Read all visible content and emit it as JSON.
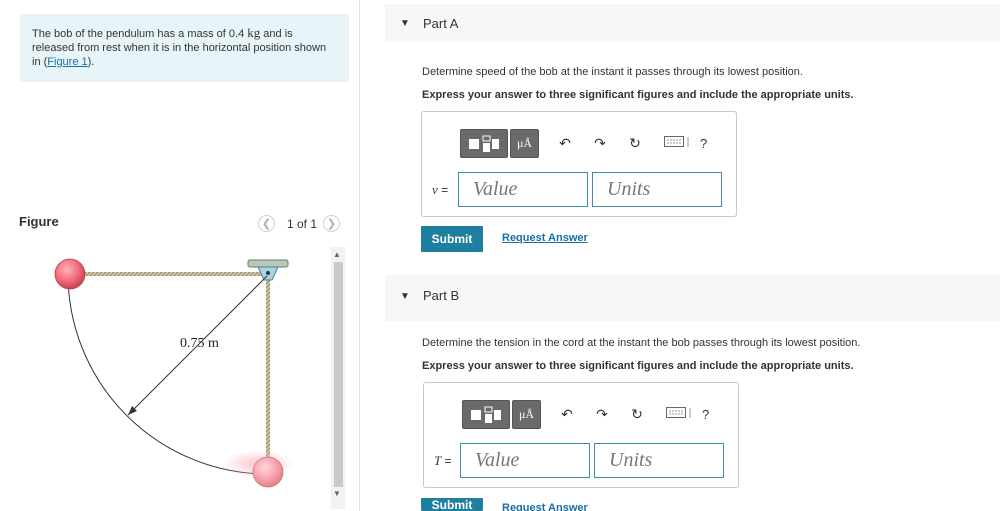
{
  "problem": {
    "text_before": "The bob of the pendulum has a mass of 0.4 ",
    "unit": "kg",
    "text_after": " and is released from rest when it is in the horizontal position shown in (",
    "figure_link": "Figure 1",
    "text_end": ")."
  },
  "figure": {
    "label": "Figure",
    "counter": "1 of 1",
    "length_label": "0.75 m"
  },
  "part_a": {
    "title": "Part A",
    "question": "Determine speed of the bob at the instant it passes through its lowest position.",
    "instruction": "Express your answer to three significant figures and include the appropriate units.",
    "var": "v",
    "eq": " =",
    "value_placeholder": "Value",
    "units_placeholder": "Units",
    "submit": "Submit",
    "request": "Request Answer"
  },
  "part_b": {
    "title": "Part B",
    "question": "Determine the tension in the cord at the instant the bob passes through its lowest position.",
    "instruction": "Express your answer to three significant figures and include the appropriate units.",
    "var": "T",
    "eq": " =",
    "value_placeholder": "Value",
    "units_placeholder": "Units",
    "submit": "Submit",
    "request": "Request Answer"
  },
  "toolbar": {
    "mu_label": "μÅ",
    "help": "?"
  },
  "colors": {
    "accent": "#1f7fa0",
    "link": "#1a6fa8",
    "problem_bg": "#e8f5f8",
    "bob": "#f06b7a"
  }
}
